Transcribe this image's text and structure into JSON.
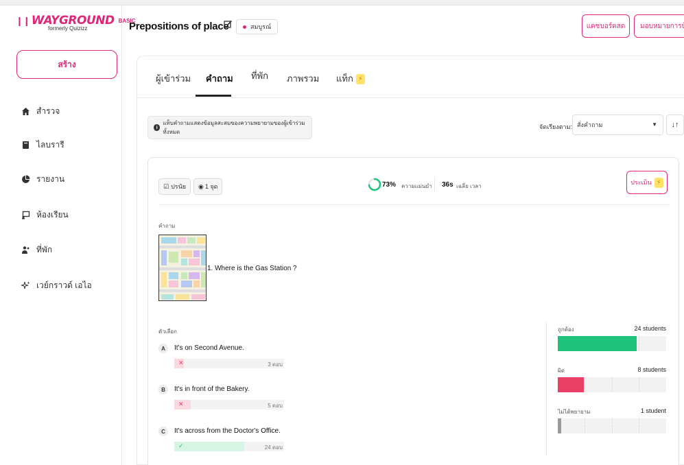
{
  "brand": {
    "name": "WAYGROUND",
    "plan": "BASIC",
    "subtitle": "formerly Quizizz",
    "color": "#e0267a"
  },
  "sidebar": {
    "create_label": "สร้าง",
    "items": [
      {
        "icon": "home-icon",
        "label": "สำรวจ"
      },
      {
        "icon": "library-icon",
        "label": "ไลบรารี"
      },
      {
        "icon": "report-icon",
        "label": "รายงาน"
      },
      {
        "icon": "classroom-icon",
        "label": "ห้องเรียน"
      },
      {
        "icon": "accommodations-icon",
        "label": "ที่พัก"
      },
      {
        "icon": "ai-sparkle-icon",
        "label": "เวย์กราวด์ เอไอ"
      }
    ]
  },
  "header": {
    "title": "Prepositions of place",
    "status": "สมบูรณ์",
    "live_dashboard_label": "แดชบอร์ดสด",
    "assign_label": "มอบหมายการบ้"
  },
  "tabs": [
    {
      "label": "ผู้เข้าร่วม",
      "active": false
    },
    {
      "label": "คำถาม",
      "active": true
    },
    {
      "label": "ที่พัก",
      "active": false
    },
    {
      "label": "ภาพรวม",
      "active": false
    },
    {
      "label": "แท็ก",
      "active": false,
      "badge": "⚡"
    }
  ],
  "info_text": "แท็บคำถามแสดงข้อมูลสะสมของความพยายามของผู้เข้าร่วมทั้งหมด",
  "sort": {
    "label": "จัดเรียงตาม:",
    "value": "สั่งคำถาม"
  },
  "question": {
    "type_chip": "ปรนัย",
    "points_chip": "1 จุด",
    "accuracy": "73%",
    "accuracy_value": 0.73,
    "accuracy_label": "ความแม่นยำ",
    "avg_time": "36s",
    "avg_time_label": "เฉลี่ย เวลา",
    "grade_label": "ประเมิน",
    "section_label": "คำถาม",
    "text": "1. Where is the Gas Station ?",
    "options_label": "ตัวเลือก",
    "options": [
      {
        "letter": "A",
        "text": "It's on Second Avenue.",
        "count": "3 ตอบ",
        "correct": false,
        "share": 0.09
      },
      {
        "letter": "B",
        "text": "It's in front of the Bakery.",
        "count": "5 ตอบ",
        "correct": false,
        "share": 0.15
      },
      {
        "letter": "C",
        "text": "It's across from the Doctor's Office.",
        "count": "24 ตอบ",
        "correct": true,
        "share": 0.64
      }
    ]
  },
  "stats": [
    {
      "label": "ถูกต้อง",
      "value": "24 students",
      "fraction": 0.73,
      "color": "#1ec27a"
    },
    {
      "label": "ผิด",
      "value": "8 students",
      "fraction": 0.24,
      "color": "#ea3f66"
    },
    {
      "label": "ไม่ได้พยายาม",
      "value": "1 student",
      "fraction": 0.03,
      "color": "#9a9a9a"
    }
  ],
  "colors": {
    "accent": "#e0267a",
    "correct": "#1ec27a",
    "wrong": "#ea3f66",
    "correct_bg": "#d7f4e5",
    "wrong_bg": "#fbd9e0"
  }
}
